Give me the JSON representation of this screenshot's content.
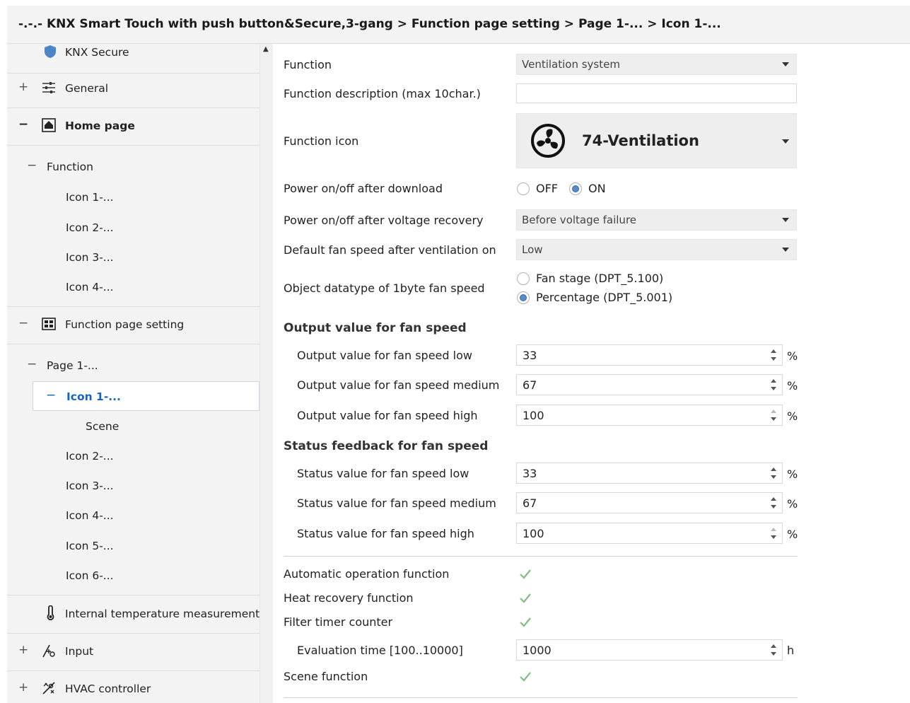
{
  "title": "-.-.- KNX Smart Touch with push button&Secure,3-gang > Function page setting > Page 1-... > Icon 1-...",
  "sidebar": {
    "items": [
      {
        "label": "KNX Secure",
        "icon": "shield-icon"
      },
      {
        "label": "General",
        "icon": "sliders-icon",
        "toggle": "+"
      },
      {
        "label": "Home page",
        "icon": "home-icon",
        "toggle": "−"
      },
      {
        "label": "Function",
        "toggle": "−"
      },
      {
        "label": "Icon 1-..."
      },
      {
        "label": "Icon 2-..."
      },
      {
        "label": "Icon 3-..."
      },
      {
        "label": "Icon 4-..."
      },
      {
        "label": "Function page setting",
        "icon": "grid-icon",
        "toggle": "−"
      },
      {
        "label": "Page 1-...",
        "toggle": "−"
      },
      {
        "label": "Icon 1-...",
        "toggle": "−"
      },
      {
        "label": "Scene"
      },
      {
        "label": "Icon 2-..."
      },
      {
        "label": "Icon 3-..."
      },
      {
        "label": "Icon 4-..."
      },
      {
        "label": "Icon 5-..."
      },
      {
        "label": "Icon 6-..."
      },
      {
        "label": "Internal temperature measurement",
        "icon": "thermometer-icon"
      },
      {
        "label": "Input",
        "icon": "input-icon",
        "toggle": "+"
      },
      {
        "label": "HVAC controller",
        "icon": "hvac-icon",
        "toggle": "+"
      }
    ]
  },
  "form": {
    "function_label": "Function",
    "function_value": "Ventilation system",
    "desc_label": "Function description (max 10char.)",
    "desc_value": "",
    "icon_label": "Function icon",
    "icon_value": "74-Ventilation",
    "power_dl_label": "Power on/off after download",
    "power_dl_off": "OFF",
    "power_dl_on": "ON",
    "power_dl_selected": "ON",
    "power_vr_label": "Power on/off after voltage recovery",
    "power_vr_value": "Before voltage failure",
    "fan_default_label": "Default fan speed after ventilation on",
    "fan_default_value": "Low",
    "datatype_label": "Object datatype of 1byte fan speed",
    "datatype_opt1": "Fan stage (DPT_5.100)",
    "datatype_opt2": "Percentage (DPT_5.001)",
    "datatype_selected": "Percentage (DPT_5.001)",
    "output_title": "Output value for fan speed",
    "out_low_label": "Output value for fan speed low",
    "out_low_value": "33",
    "out_med_label": "Output value for fan speed medium",
    "out_med_value": "67",
    "out_high_label": "Output value for fan speed high",
    "out_high_value": "100",
    "status_title": "Status feedback for fan speed",
    "st_low_label": "Status value for fan speed low",
    "st_low_value": "33",
    "st_med_label": "Status value for fan speed medium",
    "st_med_value": "67",
    "st_high_label": "Status value for fan speed high",
    "st_high_value": "100",
    "percent_unit": "%",
    "auto_label": "Automatic operation function",
    "auto_checked": true,
    "heat_label": "Heat recovery function",
    "heat_checked": true,
    "filter_label": "Filter timer counter",
    "filter_checked": true,
    "eval_label": "Evaluation time [100..10000]",
    "eval_value": "1000",
    "eval_unit": "h",
    "scene_label": "Scene function",
    "scene_checked": true
  },
  "colors": {
    "accent": "#1565c0",
    "check": "#7fbf7f",
    "sidebar_bg": "#f3f3f3"
  }
}
